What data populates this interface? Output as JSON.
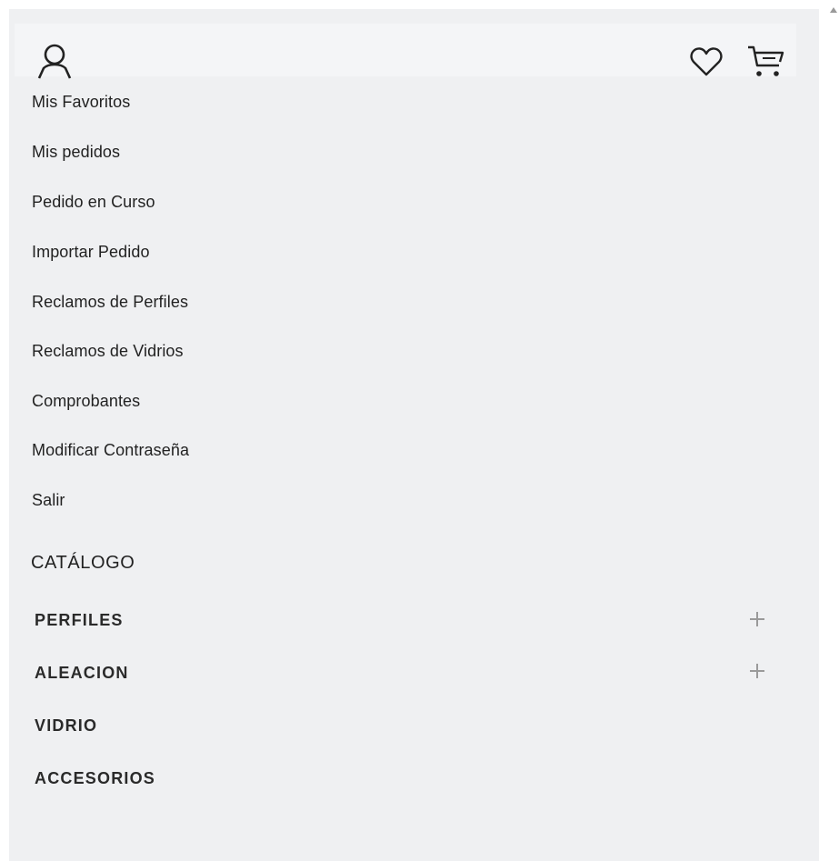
{
  "header": {
    "user_icon": "user-icon",
    "favorites_icon": "heart-icon",
    "cart_icon": "cart-icon"
  },
  "account_menu": [
    {
      "label": "Mis Favoritos"
    },
    {
      "label": "Mis pedidos"
    },
    {
      "label": "Pedido en Curso"
    },
    {
      "label": "Importar Pedido"
    },
    {
      "label": "Reclamos de Perfiles"
    },
    {
      "label": "Reclamos de Vidrios"
    },
    {
      "label": "Comprobantes"
    },
    {
      "label": "Modificar Contraseña"
    },
    {
      "label": "Salir"
    }
  ],
  "catalog": {
    "title": "CATÁLOGO",
    "items": [
      {
        "label": "PERFILES",
        "expandable": true
      },
      {
        "label": "ALEACION",
        "expandable": true
      },
      {
        "label": "VIDRIO",
        "expandable": false
      },
      {
        "label": "ACCESORIOS",
        "expandable": false
      }
    ]
  },
  "colors": {
    "panel_bg": "#eff0f2",
    "header_bg": "#f4f5f7",
    "text": "#222222",
    "icon_muted": "#9a9a9a"
  }
}
